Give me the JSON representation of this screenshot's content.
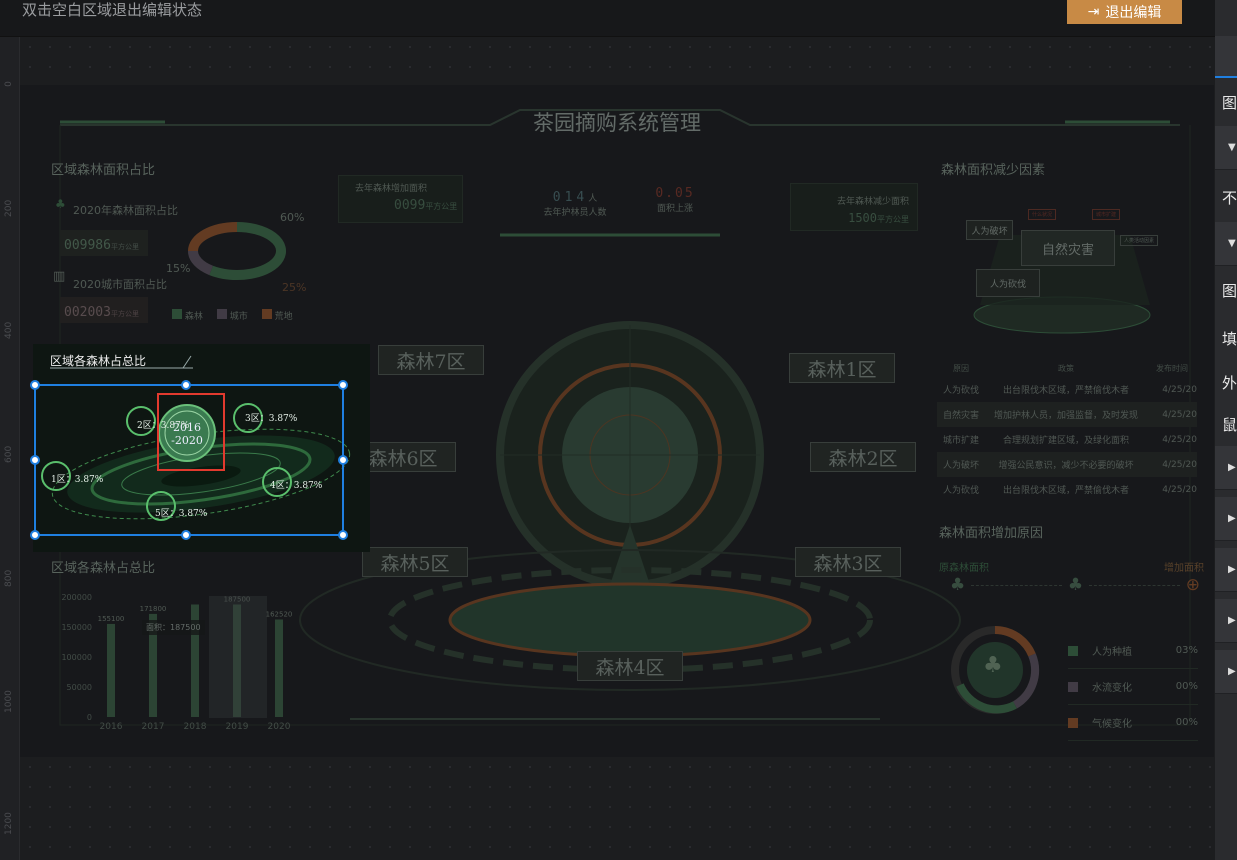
{
  "editor": {
    "hint": "双击空白区域退出编辑状态",
    "exit_button": "退出编辑",
    "ruler_ticks": [
      "0",
      "200",
      "400",
      "600",
      "800",
      "1000",
      "1200"
    ]
  },
  "dashboard": {
    "title": "茶园摘购系统管理",
    "left_top": {
      "title": "区域森林面积占比",
      "forest_caption": "2020年森林面积占比",
      "forest_value": "009986",
      "forest_unit": "平方公里",
      "city_caption": "2020城市面积占比",
      "city_value": "002003",
      "city_unit": "平方公里",
      "donut": {
        "pct_forest": "60%",
        "pct_city": "15%",
        "pct_waste": "25%",
        "values": [
          60,
          15,
          25
        ],
        "colors": [
          "#3f6b4d",
          "#5a5360",
          "#8a5230"
        ]
      },
      "legend": [
        "森林",
        "城市",
        "荒地"
      ]
    },
    "center_stats": {
      "added_label": "去年森林增加面积",
      "added_value": "0099",
      "added_unit": "平方公里",
      "people_value": "014",
      "people_unit": "人",
      "people_label": "去年护林员人数",
      "rise_value": "0.05",
      "rise_label": "面积上涨",
      "reduced_label": "去年森林减少面积",
      "reduced_value": "1500",
      "reduced_unit": "平方公里"
    },
    "zones": [
      "森林7区",
      "森林1区",
      "森林6区",
      "森林2区",
      "森林5区",
      "森林3区",
      "森林4区"
    ],
    "reduce_factors": {
      "title": "森林面积减少因素",
      "main": "自然灾害",
      "nodes": [
        "人为破坏",
        "人为砍伐"
      ],
      "small_nodes": [
        "什么状况",
        "城市扩建",
        "人类活动因素"
      ]
    },
    "table": {
      "headers": [
        "原因",
        "政策",
        "发布时间"
      ],
      "rows": [
        [
          "人为砍伐",
          "出台限伐木区域，严禁偷伐木者",
          "4/25/20"
        ],
        [
          "自然灾害",
          "增加护林人员，加强监督，及时发现",
          "4/25/20"
        ],
        [
          "城市扩建",
          "合理规划扩建区域，及绿化面积",
          "4/25/20"
        ],
        [
          "人为破坏",
          "增强公民意识，减少不必要的破坏",
          "4/25/20"
        ],
        [
          "人为砍伐",
          "出台限伐木区域，严禁偷伐木者",
          "4/25/20"
        ]
      ]
    },
    "increase": {
      "title": "森林面积增加原因",
      "left_tag": "原森林面积",
      "right_tag": "增加面积",
      "items": [
        {
          "label": "人为种植",
          "value": "03%"
        },
        {
          "label": "水流变化",
          "value": "00%"
        },
        {
          "label": "气候变化",
          "value": "00%"
        }
      ],
      "colors": [
        "#3f6b4d",
        "#5a5360",
        "#8a5230"
      ]
    },
    "selected": {
      "title": "区域各森林占总比",
      "center_line1": "2016",
      "center_line2": "-2020",
      "nodes": [
        "1区：3.87%",
        "2区：3.87%",
        "3区：3.87%",
        "4区：3.87%",
        "5区：3.87%"
      ]
    }
  },
  "chart_data": {
    "type": "bar",
    "title": "区域各森林占总比",
    "categories": [
      "2016",
      "2017",
      "2018",
      "2019",
      "2020"
    ],
    "values": [
      155100,
      171800,
      187500,
      187500,
      162520
    ],
    "value_labels": [
      "155100",
      "171800",
      "",
      "187500",
      "162520"
    ],
    "ylim": [
      0,
      200000
    ],
    "yticks": [
      "200000",
      "150000",
      "100000",
      "50000",
      "0"
    ],
    "tooltip": {
      "label": "面积：",
      "value": "187500"
    },
    "color": "#3e5f49"
  }
}
